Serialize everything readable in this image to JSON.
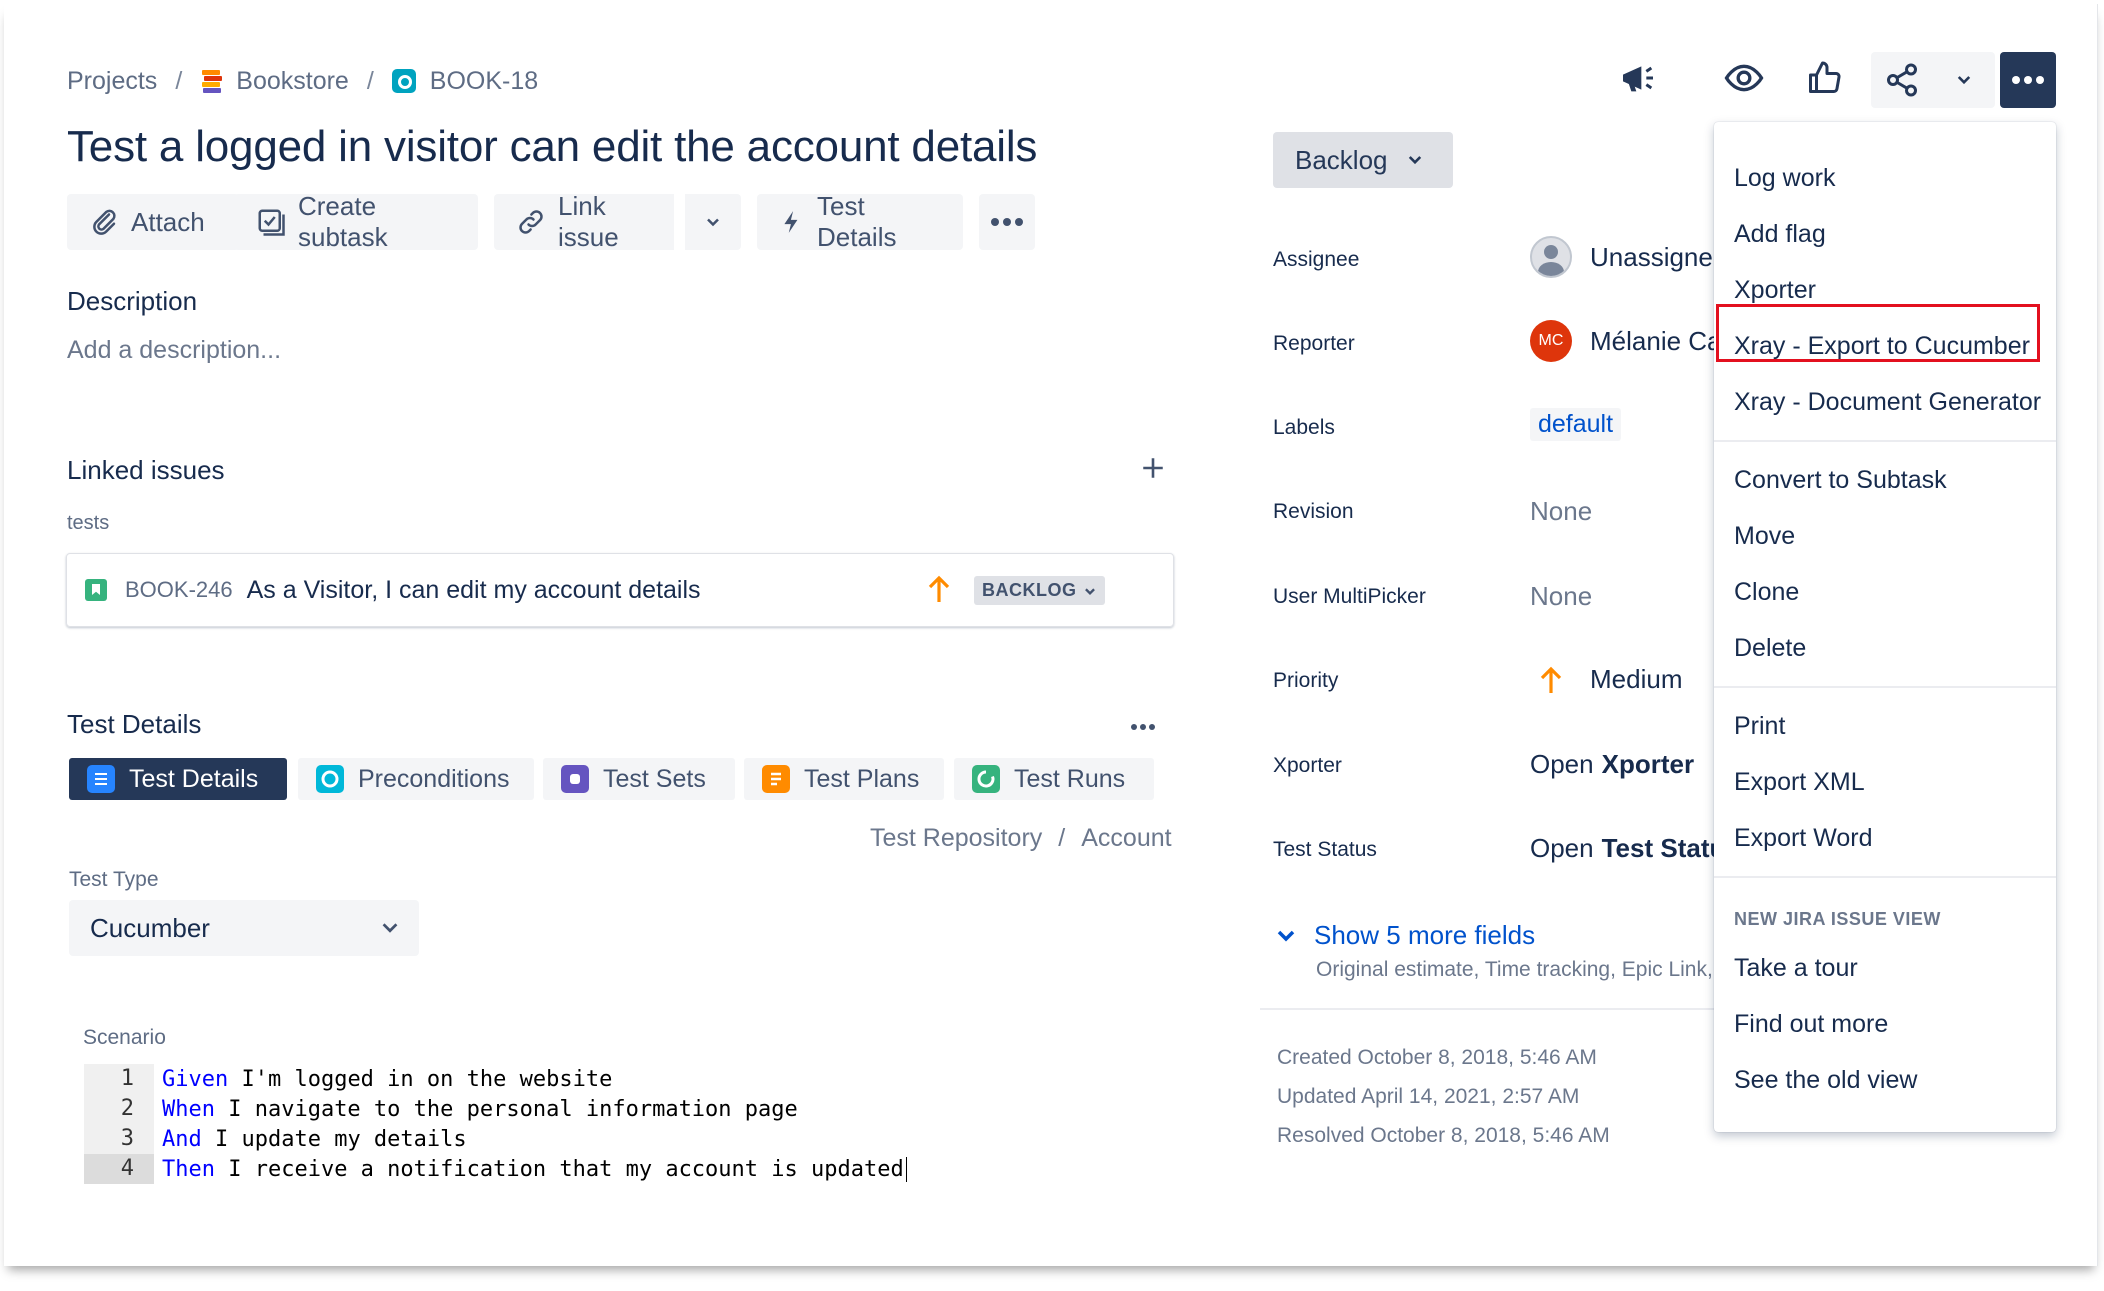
{
  "breadcrumb": {
    "projects": "Projects",
    "project": "Bookstore",
    "issue_key": "BOOK-18",
    "sep": "/"
  },
  "issue": {
    "title": "Test a logged in visitor can edit the account details"
  },
  "actions": {
    "attach": "Attach",
    "create_subtask": "Create subtask",
    "link_issue": "Link issue",
    "test_details": "Test Details"
  },
  "description": {
    "heading": "Description",
    "placeholder": "Add a description..."
  },
  "linked": {
    "heading": "Linked issues",
    "relation": "tests",
    "items": [
      {
        "key": "BOOK-246",
        "summary": "As a Visitor, I can edit my account details",
        "status": "BACKLOG"
      }
    ]
  },
  "test_details": {
    "heading": "Test Details",
    "tabs": [
      "Test Details",
      "Preconditions",
      "Test Sets",
      "Test Plans",
      "Test Runs"
    ],
    "repo_path": {
      "root": "Test Repository",
      "sep": "/",
      "folder": "Account"
    },
    "test_type_label": "Test Type",
    "test_type_value": "Cucumber",
    "scenario_label": "Scenario",
    "scenario_lines": [
      {
        "n": "1",
        "kw": "Given",
        "rest": " I'm logged in on the website"
      },
      {
        "n": "2",
        "kw": "When",
        "rest": " I navigate to the personal information page"
      },
      {
        "n": "3",
        "kw": "And",
        "rest": " I update my details"
      },
      {
        "n": "4",
        "kw": "Then",
        "rest": " I receive a notification that my account is updated"
      }
    ]
  },
  "status": {
    "label": "Backlog"
  },
  "fields": {
    "assignee": {
      "label": "Assignee",
      "value": "Unassigned"
    },
    "reporter": {
      "label": "Reporter",
      "value": "Mélanie Ca",
      "initials": "MC"
    },
    "labels": {
      "label": "Labels",
      "value": "default"
    },
    "revision": {
      "label": "Revision",
      "value": "None"
    },
    "user_multipicker": {
      "label": "User MultiPicker",
      "value": "None"
    },
    "priority": {
      "label": "Priority",
      "value": "Medium"
    },
    "xporter": {
      "label": "Xporter",
      "prefix": "Open",
      "value": "Xporter"
    },
    "test_status": {
      "label": "Test Status",
      "prefix": "Open",
      "value": "Test Status"
    }
  },
  "more_fields": {
    "link": "Show 5 more fields",
    "sub": "Original estimate, Time tracking, Epic Link,"
  },
  "dates": {
    "created": "Created October 8, 2018, 5:46 AM",
    "updated": "Updated April 14, 2021, 2:57 AM",
    "resolved": "Resolved October 8, 2018, 5:46 AM"
  },
  "menu": {
    "group1": [
      "Log work",
      "Add flag",
      "Xporter",
      "Xray - Export to Cucumber",
      "Xray - Document Generator"
    ],
    "group2": [
      "Convert to Subtask",
      "Move",
      "Clone",
      "Delete"
    ],
    "group3": [
      "Print",
      "Export XML",
      "Export Word"
    ],
    "heading": "NEW JIRA ISSUE VIEW",
    "group4": [
      "Take a tour",
      "Find out more",
      "See the old view"
    ]
  },
  "colors": {
    "accent": "#0052cc",
    "dark_button": "#253858",
    "highlight_box": "#e3101f",
    "priority": "#ff8b00"
  }
}
